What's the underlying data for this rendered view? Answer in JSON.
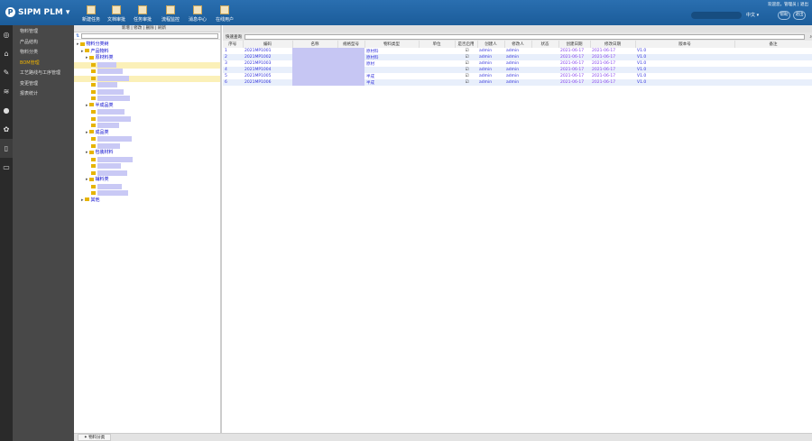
{
  "header": {
    "app_name": "SIPM PLM",
    "user_info": "欢迎您，管理员 | 退出",
    "toolbar": [
      {
        "label": "新建任务",
        "icon": "edit-icon"
      },
      {
        "label": "文档审批",
        "icon": "doc-icon"
      },
      {
        "label": "任务审批",
        "icon": "doc-gear-icon"
      },
      {
        "label": "流程监控",
        "icon": "monitor-icon"
      },
      {
        "label": "消息中心",
        "icon": "inbox-icon"
      },
      {
        "label": "在线用户",
        "icon": "users-icon"
      }
    ],
    "select_value": "中文",
    "buttons": [
      "帮助",
      "退出"
    ]
  },
  "rail": [
    "search-icon",
    "home-icon",
    "edit-icon",
    "layers-icon",
    "globe-icon",
    "gear-icon",
    "book-icon",
    "card-icon"
  ],
  "menu": {
    "items": [
      "物料管理",
      "产品结构",
      "物料分类",
      "BOM管理",
      "工艺路线与工序管理",
      "变更管理",
      "报表统计"
    ],
    "active": 3
  },
  "tree": {
    "toolbar": "新增 | 修改 | 删除 | 刷新",
    "nodes": [
      {
        "label": "物料分类树",
        "level": 0
      },
      {
        "label": "产品物料",
        "level": 1
      },
      {
        "label": "原材料类",
        "level": 2
      },
      {
        "label": "",
        "level": 3,
        "hl": true
      },
      {
        "label": "",
        "level": 3
      },
      {
        "label": "",
        "level": 3,
        "hl": true
      },
      {
        "label": "",
        "level": 3
      },
      {
        "label": "",
        "level": 3
      },
      {
        "label": "",
        "level": 3
      },
      {
        "label": "半成品类",
        "level": 2
      },
      {
        "label": "",
        "level": 3
      },
      {
        "label": "",
        "level": 3
      },
      {
        "label": "",
        "level": 3
      },
      {
        "label": "成品类",
        "level": 2
      },
      {
        "label": "",
        "level": 3
      },
      {
        "label": "",
        "level": 3
      },
      {
        "label": "包装材料",
        "level": 2
      },
      {
        "label": "",
        "level": 3
      },
      {
        "label": "",
        "level": 3
      },
      {
        "label": "",
        "level": 3
      },
      {
        "label": "辅料类",
        "level": 2
      },
      {
        "label": "",
        "level": 3
      },
      {
        "label": "",
        "level": 3
      },
      {
        "label": "其他",
        "level": 1
      }
    ]
  },
  "grid": {
    "search_label": "快速查询",
    "columns": [
      "序号",
      "编码",
      "名称",
      "规格型号",
      "物料类型",
      "单位",
      "是否启用",
      "创建人",
      "修改人",
      "状态",
      "创建日期",
      "修改日期",
      "版本号",
      "备注"
    ],
    "rows": [
      [
        "1",
        "2021MP1001",
        "",
        "",
        "原材料",
        "",
        "☑",
        "admin",
        "admin",
        "",
        "2021-06-17",
        "2021-06-17",
        "V1.0",
        ""
      ],
      [
        "2",
        "2021MP1002",
        "",
        "",
        "原材料",
        "",
        "☑",
        "admin",
        "admin",
        "",
        "2021-06-17",
        "2021-06-17",
        "V1.0",
        ""
      ],
      [
        "3",
        "2021MP1003",
        "",
        "",
        "原材",
        "",
        "☑",
        "admin",
        "admin",
        "",
        "2021-06-17",
        "2021-06-17",
        "V1.0",
        ""
      ],
      [
        "4",
        "2021MP1004",
        "",
        "",
        "",
        "",
        "☑",
        "admin",
        "admin",
        "",
        "2021-06-17",
        "2021-06-17",
        "V1.0",
        ""
      ],
      [
        "5",
        "2021MP1005",
        "",
        "",
        "半成",
        "",
        "☑",
        "admin",
        "admin",
        "",
        "2021-06-17",
        "2021-06-17",
        "V1.0",
        ""
      ],
      [
        "6",
        "2021MP1006",
        "",
        "",
        "半成",
        "",
        "☑",
        "admin",
        "admin",
        "",
        "2021-06-17",
        "2021-06-17",
        "V1.0",
        ""
      ]
    ]
  },
  "bottom_tab": "物料分类"
}
